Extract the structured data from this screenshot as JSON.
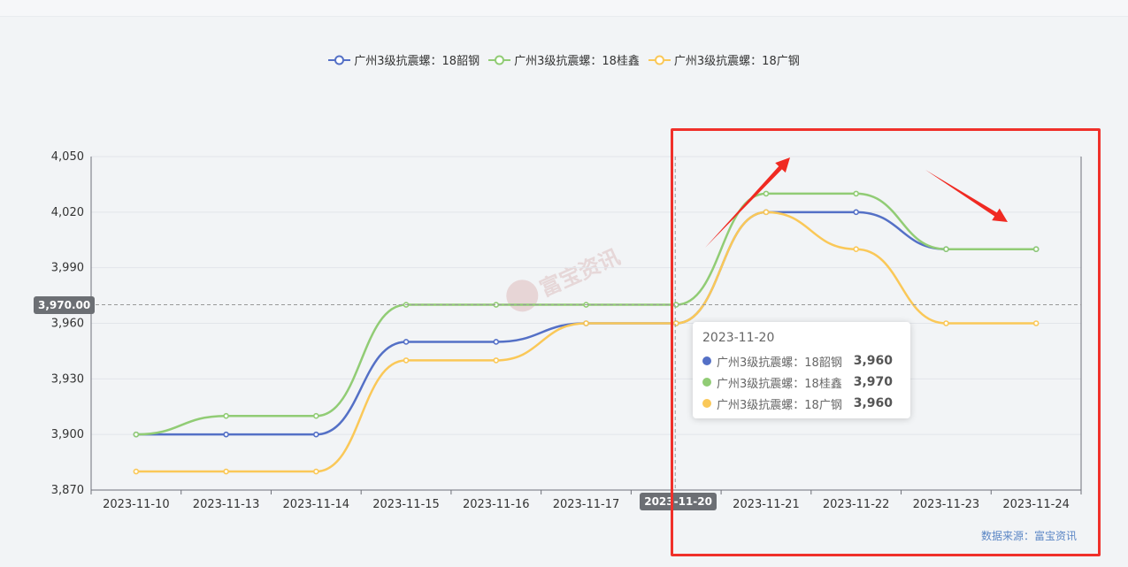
{
  "legend": {
    "items": [
      {
        "label": "广州3级抗震螺：18韶钢",
        "color": "#5470c6"
      },
      {
        "label": "广州3级抗震螺：18桂鑫",
        "color": "#91cc75"
      },
      {
        "label": "广州3级抗震螺：18广钢",
        "color": "#fac858"
      }
    ]
  },
  "tooltip": {
    "date": "2023-11-20",
    "rows": [
      {
        "name": "广州3级抗震螺：18韶钢",
        "value": "3,960",
        "color": "#5470c6"
      },
      {
        "name": "广州3级抗震螺：18桂鑫",
        "value": "3,970",
        "color": "#91cc75"
      },
      {
        "name": "广州3级抗震螺：18广钢",
        "value": "3,960",
        "color": "#fac858"
      }
    ]
  },
  "crosshair": {
    "y_label": "3,970.00",
    "x_label": "2023-11-20",
    "y_value": 3970,
    "x_category": "2023-11-20"
  },
  "source": "数据来源：富宝资讯",
  "watermark": "富宝资讯",
  "chart_data": {
    "type": "line",
    "smooth": true,
    "categories": [
      "2023-11-10",
      "2023-11-13",
      "2023-11-14",
      "2023-11-15",
      "2023-11-16",
      "2023-11-17",
      "2023-11-20",
      "2023-11-21",
      "2023-11-22",
      "2023-11-23",
      "2023-11-24"
    ],
    "yticks": [
      "3,870",
      "3,900",
      "3,930",
      "3,960",
      "3,990",
      "4,020",
      "4,050"
    ],
    "ylim": [
      3870,
      4050
    ],
    "grid": true,
    "legend_position": "top",
    "series": [
      {
        "name": "广州3级抗震螺：18韶钢",
        "color": "#5470c6",
        "values": [
          3900,
          3900,
          3900,
          3950,
          3950,
          3960,
          3960,
          4020,
          4020,
          4000,
          4000
        ]
      },
      {
        "name": "广州3级抗震螺：18桂鑫",
        "color": "#91cc75",
        "values": [
          3900,
          3910,
          3910,
          3970,
          3970,
          3970,
          3970,
          4030,
          4030,
          4000,
          4000
        ]
      },
      {
        "name": "广州3级抗震螺：18广钢",
        "color": "#fac858",
        "values": [
          3880,
          3880,
          3880,
          3940,
          3940,
          3960,
          3960,
          4020,
          4000,
          3960,
          3960
        ]
      }
    ]
  }
}
